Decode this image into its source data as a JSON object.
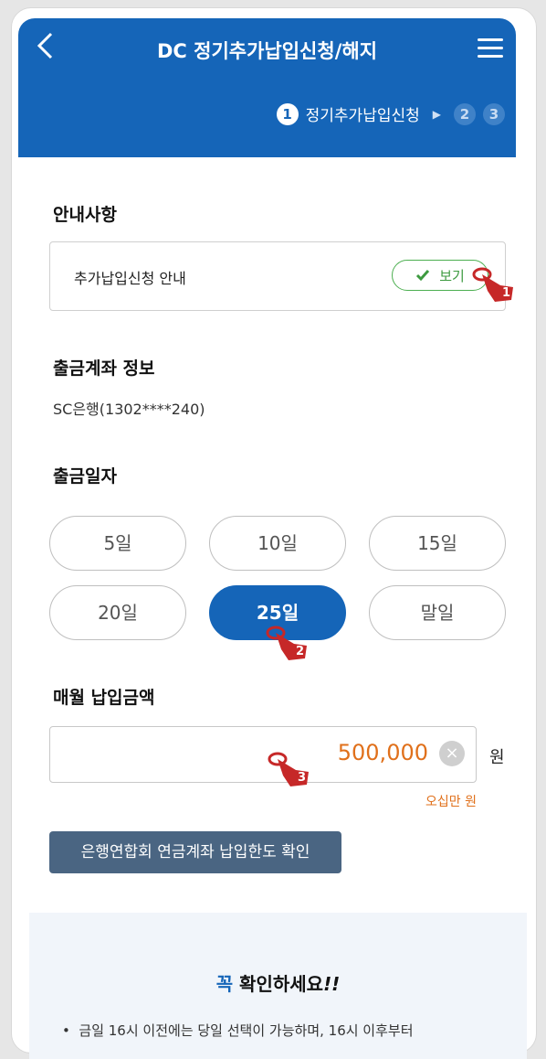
{
  "header": {
    "back_icon": "chevron-left-icon",
    "title": "DC 정기추가납입신청/해지",
    "menu_icon": "hamburger-menu-icon",
    "steps": [
      {
        "number": "1",
        "label": "정기추가납입신청",
        "active": true
      },
      {
        "number": "2",
        "active": false
      },
      {
        "number": "3",
        "active": false
      }
    ]
  },
  "guide": {
    "title": "안내사항",
    "item_label": "추가납입신청 안내",
    "view_label": "보기"
  },
  "account": {
    "title": "출금계좌 정보",
    "value": "SC은행(1302****240)"
  },
  "withdraw_date": {
    "title": "출금일자",
    "options": [
      "5일",
      "10일",
      "15일",
      "20일",
      "25일",
      "말일"
    ],
    "selected": "25일"
  },
  "monthly_amount": {
    "title": "매월 납입금액",
    "value": "500,000",
    "unit": "원",
    "korean_amount": "오십만 원"
  },
  "limit_button_label": "은행연합회 연금계좌 납입한도 확인",
  "notice": {
    "title_accent": "꼭",
    "title_rest": " 확인하세요",
    "title_mark": "!!",
    "items": [
      "금일 16시 이전에는 당일 선택이 가능하며, 16시 이후부터"
    ]
  },
  "annotations": [
    "1",
    "2",
    "3"
  ],
  "colors": {
    "primary": "#1565b8",
    "accent_orange": "#e0701b",
    "green": "#4caf50",
    "cursor_red": "#c62828"
  }
}
